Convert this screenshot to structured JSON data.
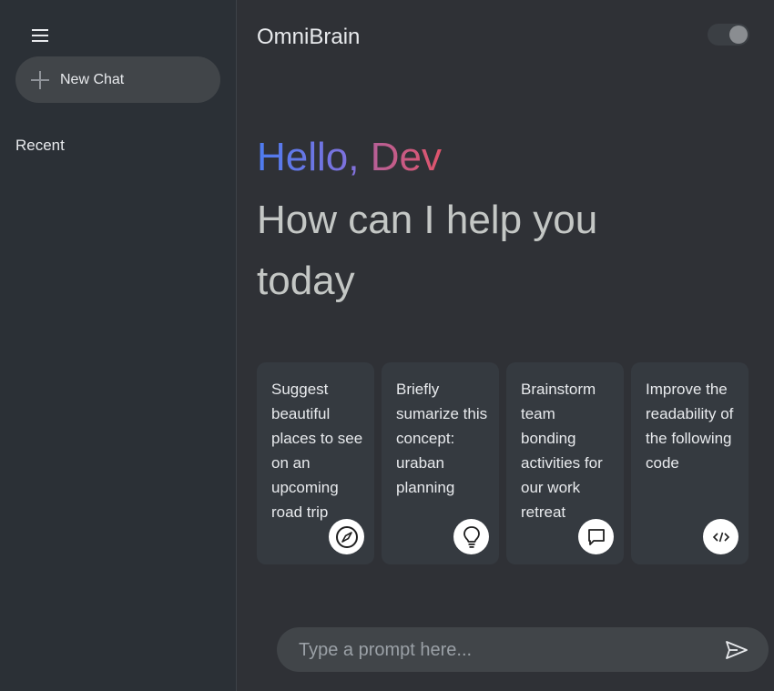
{
  "app": {
    "title": "OmniBrain"
  },
  "sidebar": {
    "new_chat_label": "New Chat",
    "recent_label": "Recent"
  },
  "greeting": {
    "hello": "Hello, ",
    "name": "Dev",
    "subtitle": "How can I help you today"
  },
  "cards": [
    {
      "text": "Suggest beautiful places to see on an upcoming road trip",
      "icon": "compass-icon"
    },
    {
      "text": "Briefly sumarize this concept: uraban planning",
      "icon": "lightbulb-icon"
    },
    {
      "text": "Brainstorm team bonding activities for our work retreat",
      "icon": "chat-bubble-icon"
    },
    {
      "text": "Improve the readability of the following code",
      "icon": "code-icon"
    }
  ],
  "prompt": {
    "placeholder": "Type a prompt here...",
    "value": ""
  },
  "theme_toggle": {
    "state": "on"
  },
  "colors": {
    "sidebar_bg": "#2b3036",
    "main_bg": "#2f3136",
    "card_bg": "#353a40",
    "gradient_blue": "#4d7cf0",
    "gradient_red": "#e0546b"
  }
}
